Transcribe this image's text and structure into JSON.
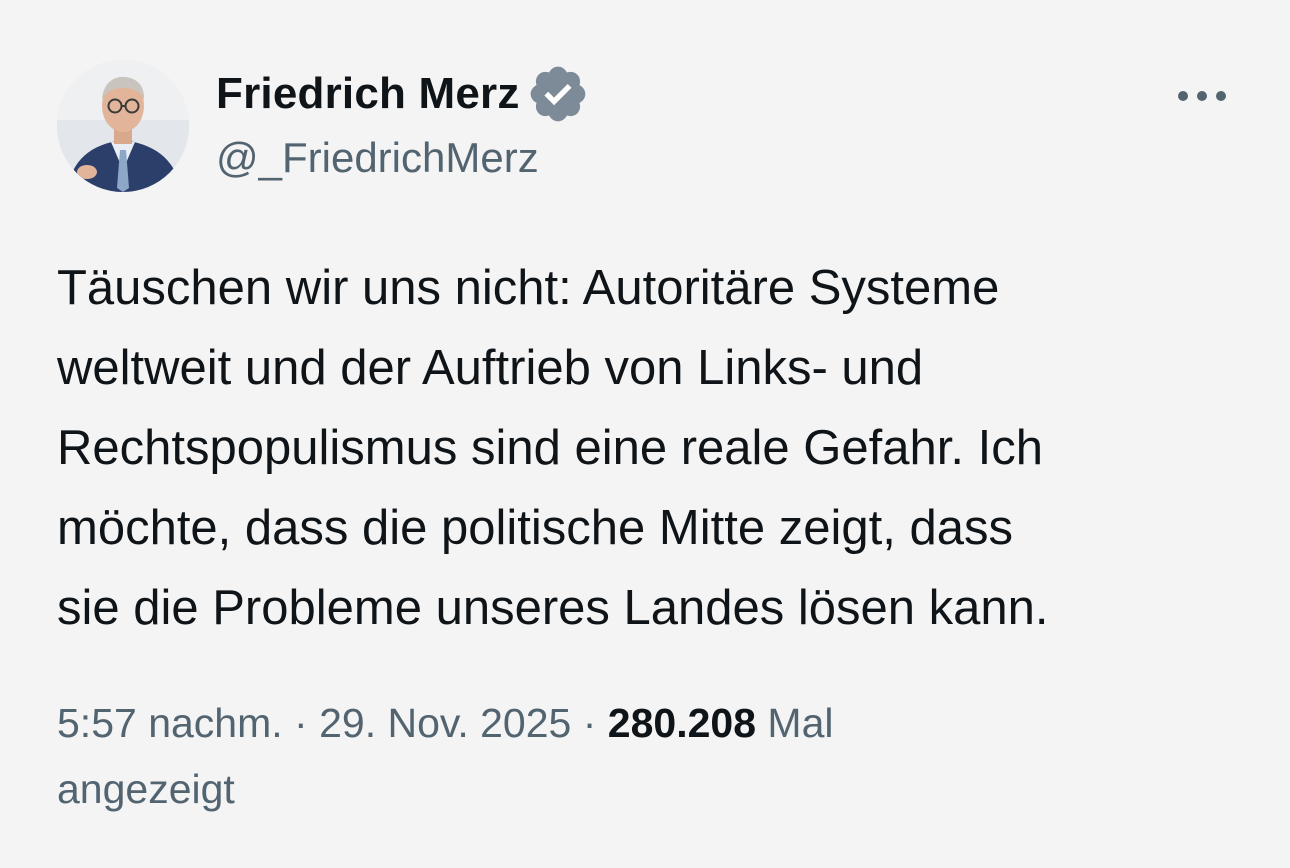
{
  "author": {
    "display_name": "Friedrich Merz",
    "handle": "@_FriedrichMerz",
    "verified": true,
    "verified_icon": "verified-badge-icon",
    "verified_color": "#7d8b99",
    "avatar": "profile-photo"
  },
  "menu": {
    "icon": "more-options-icon"
  },
  "tweet": {
    "text_lines": [
      "Täuschen wir uns nicht: Autoritäre Systeme",
      "weltweit und der Auftrieb von Links- und",
      "Rechtspopulismus sind eine reale Gefahr. Ich",
      "möchte, dass die politische Mitte zeigt, dass",
      "sie die Probleme unseres Landes lösen kann."
    ]
  },
  "meta": {
    "time": "5:57 nachm.",
    "separator": "·",
    "date": "29. Nov. 2025",
    "views_count": "280.208",
    "views_label_part1": "Mal",
    "views_label_part2": "angezeigt"
  },
  "colors": {
    "background": "#f4f4f4",
    "primary_text": "#0f1419",
    "secondary_text": "#536471"
  }
}
